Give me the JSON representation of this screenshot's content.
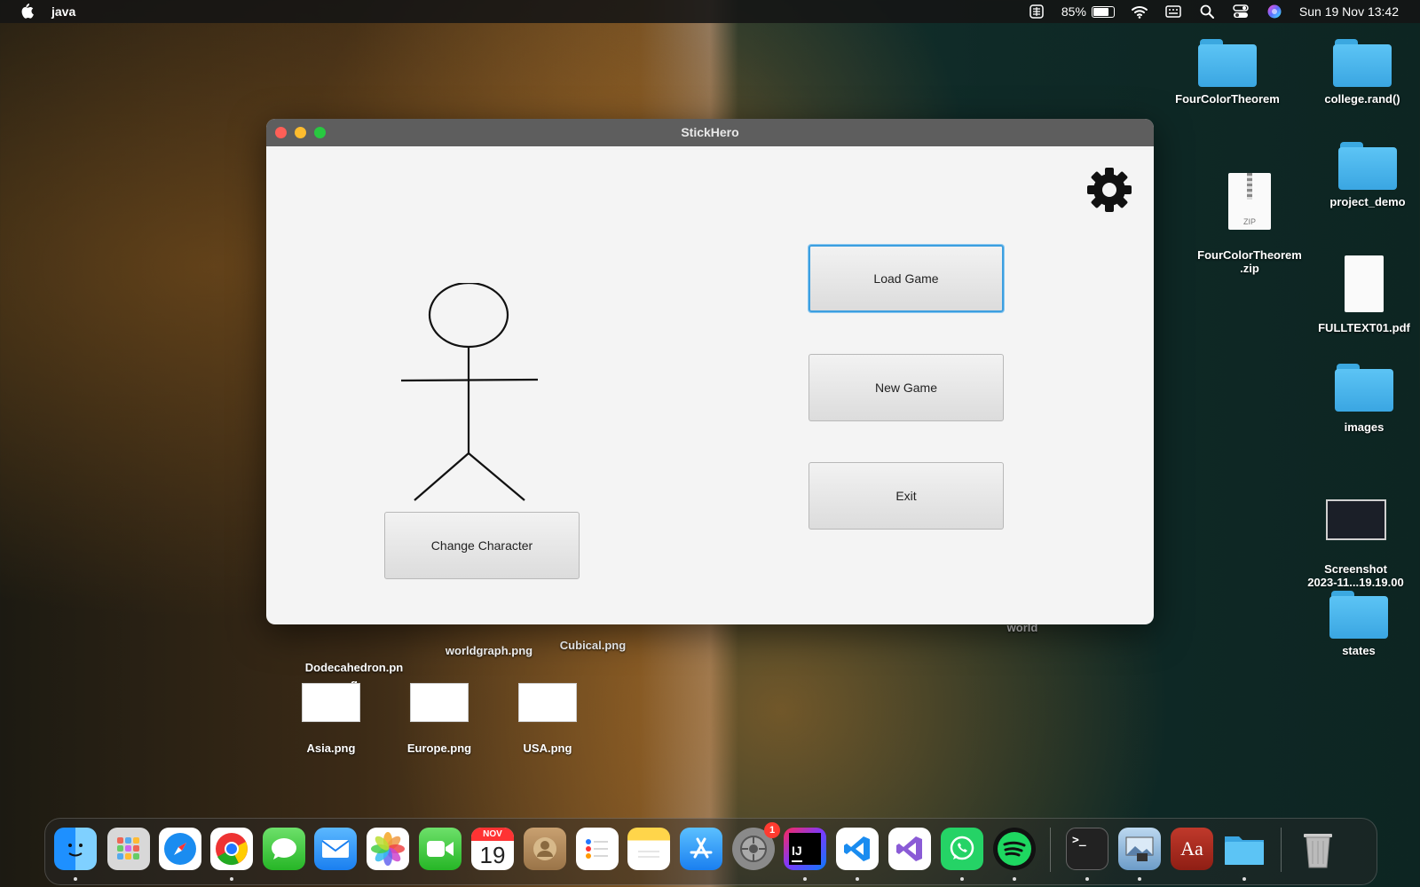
{
  "menubar": {
    "app_name": "java",
    "battery": "85%",
    "battery_level": 0.85,
    "datetime": "Sun 19 Nov  13:42"
  },
  "window": {
    "title": "StickHero",
    "buttons": {
      "load": "Load Game",
      "new": "New Game",
      "exit": "Exit",
      "change_character": "Change Character"
    },
    "focus_color": "#3c9fe0"
  },
  "desktop": {
    "right_items": [
      {
        "label": "FourColorTheorem",
        "kind": "folder"
      },
      {
        "label": "college.rand()",
        "kind": "folder"
      },
      {
        "label": "FourColorTheorem\n.zip",
        "kind": "zip"
      },
      {
        "label": "project_demo",
        "kind": "folder"
      },
      {
        "label": "FULLTEXT01.pdf",
        "kind": "pdf"
      },
      {
        "label": "images",
        "kind": "folder"
      },
      {
        "label": "Screenshot\n2023-11...19.19.00",
        "kind": "screenshot"
      },
      {
        "label": "states",
        "kind": "folder"
      }
    ],
    "bottom_items": [
      {
        "label": "Dodecahedron.pn\ng"
      },
      {
        "label": "worldgraph.png"
      },
      {
        "label": "Cubical.png"
      },
      {
        "label": "world"
      },
      {
        "label": "Asia.png"
      },
      {
        "label": "Europe.png"
      },
      {
        "label": "USA.png"
      }
    ],
    "zip_tag": "ZIP"
  },
  "dock": {
    "calendar_month": "NOV",
    "calendar_day": "19",
    "settings_badge": "1",
    "intellij_label": "IJ",
    "dictionary_label": "Aa",
    "terminal_prompt": ">_"
  }
}
